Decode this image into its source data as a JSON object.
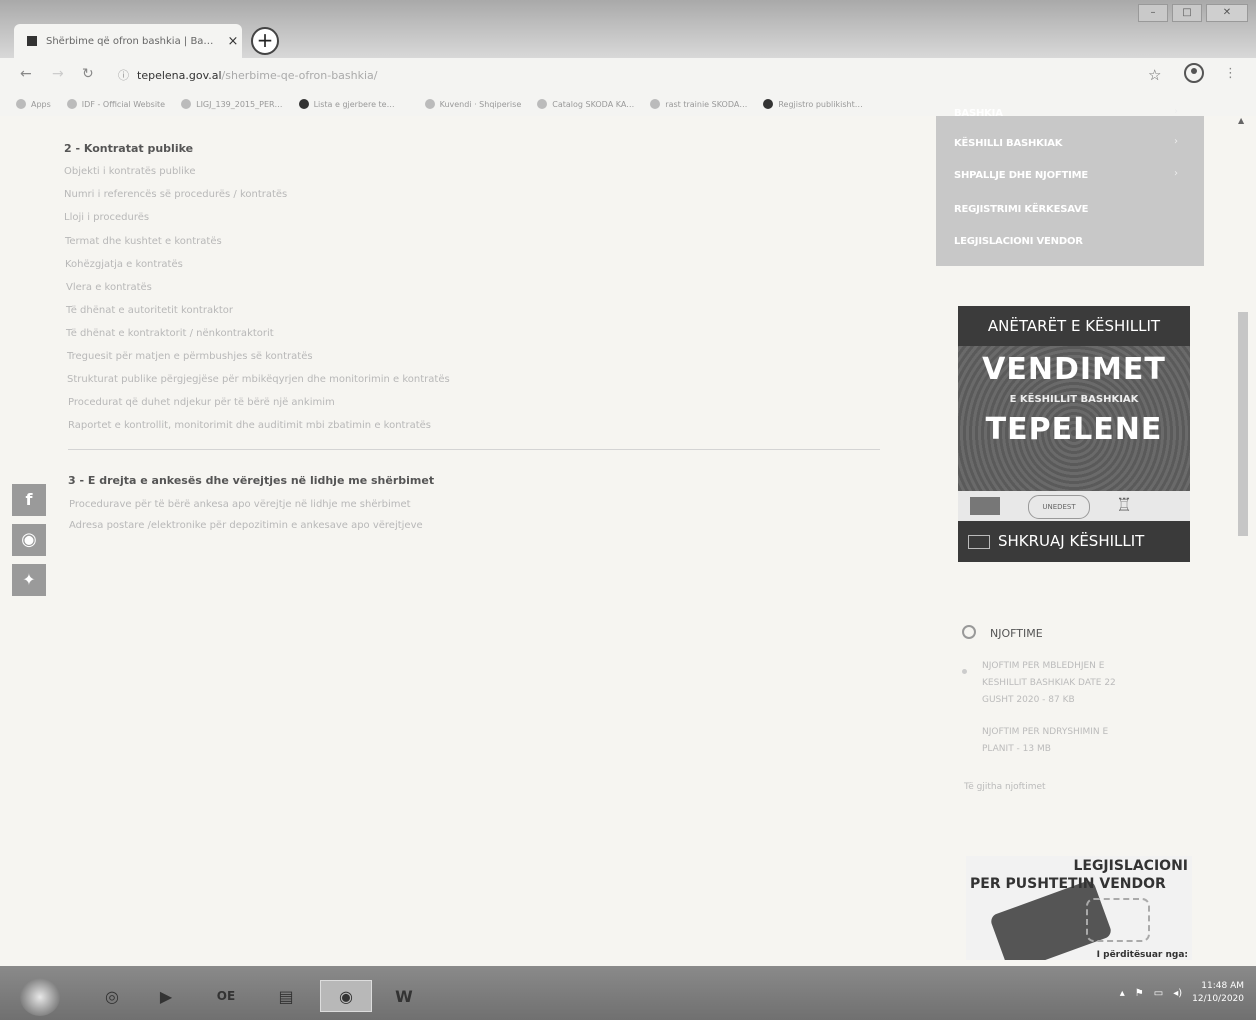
{
  "browser": {
    "tab_title": "Shërbime që ofron bashkia | Ba…",
    "tab_close": "×",
    "new_tab": "+",
    "url_host": "tepelena.gov.al",
    "url_path": "/sherbime-qe-ofron-bashkia/",
    "bookmarks": [
      "Apps",
      "IDF - Official Website",
      "LIGJ_139_2015_PER…",
      "Lista e gjerbere te…",
      "Kuvendi · Shqiperise",
      "Catalog SKODA KA…",
      "rast trainie SKODA…",
      "Regjistro publikisht…"
    ]
  },
  "main": {
    "section2": {
      "title": "2 - Kontratat publike",
      "links": [
        "Objekti i kontratës publike",
        "Numri i referencës së procedurës / kontratës",
        "Lloji i procedurës",
        "Termat dhe kushtet e kontratës",
        "Kohëzgjatja e kontratës",
        "Vlera e kontratës",
        "Të dhënat e autoritetit kontraktor",
        "Të dhënat e kontraktorit / nënkontraktorit",
        "Treguesit për matjen e përmbushjes së kontratës",
        "Strukturat publike përgjegjëse për mbikëqyrjen dhe monitorimin e kontratës",
        "Procedurat që duhet ndjekur për të bërë një ankimim",
        "Raportet e kontrollit, monitorimit dhe auditimit mbi zbatimin e kontratës"
      ]
    },
    "section3": {
      "title": "3 - E drejta e ankesës dhe vërejtjes në lidhje me shërbimet",
      "links": [
        "Procedurave për të bërë ankesa apo vërejtje në lidhje me shërbimet",
        "Adresa postare /elektronike për depozitimin e ankesave apo vërejtjeve"
      ]
    },
    "share": [
      "f",
      "◉",
      "✦"
    ]
  },
  "sidebar": {
    "menu": [
      {
        "label": "BASHKIA",
        "chevron": true
      },
      {
        "label": "KËSHILLI BASHKIAK",
        "chevron": true
      },
      {
        "label": "SHPALLJE DHE NJOFTIME",
        "chevron": true
      },
      {
        "label": "REGJISTRIMI KËRKESAVE",
        "chevron": false
      },
      {
        "label": "LEGJISLACIONI VENDOR",
        "chevron": false
      }
    ],
    "chevron_glyph": "›",
    "banner": {
      "top": "ANËTARËT E KËSHILLIT",
      "vendimet": "VENDIMET",
      "sub": "E KËSHILLIT BASHKIAK",
      "tepelene": "TEPELENE",
      "logo_text": "UNEDEST",
      "footer": "SHKRUAJ KËSHILLIT"
    },
    "njoftime": {
      "title": "NJOFTIME",
      "items": [
        [
          "NJOFTIM PER MBLEDHJEN E",
          "KESHILLIT BASHKIAK DATE 22",
          "GUSHT 2020 - 87 KB"
        ],
        [
          "NJOFTIM PER NDRYSHIMIN E",
          "PLANIT - 13 MB"
        ]
      ],
      "all": "Të gjitha njoftimet"
    },
    "legj": {
      "line1": "LEGJISLACIONI",
      "line2": "PER PUSHTETIN VENDOR",
      "line3": "I përditësuar nga:"
    }
  },
  "taskbar": {
    "time": "11:48 AM",
    "date": "12/10/2020",
    "apps": [
      "◎",
      "▶",
      "OE",
      "▤",
      "◉",
      "W"
    ]
  }
}
